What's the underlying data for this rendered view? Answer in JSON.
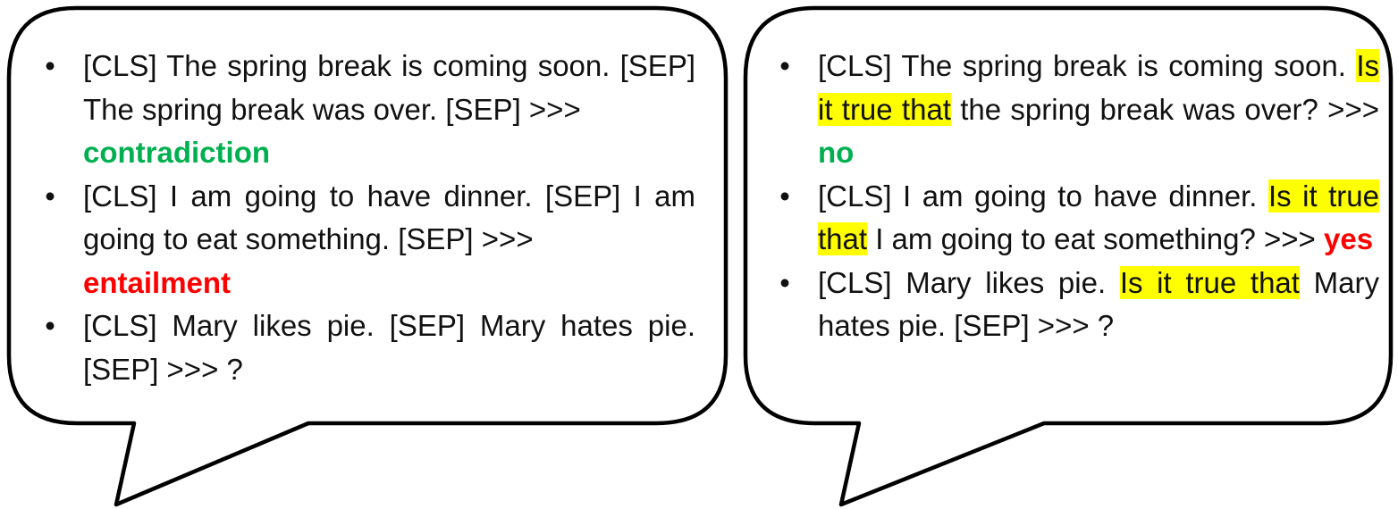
{
  "left_bubble": {
    "items": [
      {
        "text": "[CLS] The spring break is coming soon. [SEP] The spring break was over. [SEP] >>>",
        "label": "contradiction",
        "label_color": "#00b050"
      },
      {
        "text": "[CLS] I am going to have dinner. [SEP] I am going to eat something. [SEP] >>>",
        "label": "entailment",
        "label_color": "#ff0000"
      },
      {
        "text": "[CLS] Mary likes pie. [SEP] Mary hates pie. [SEP] >>> ?"
      }
    ]
  },
  "right_bubble": {
    "items": [
      {
        "before": "[CLS] The spring break is coming soon.",
        "highlight": "Is it true that",
        "after": "the spring break was over? >>>",
        "label": "no",
        "label_color": "#00b050"
      },
      {
        "before": "[CLS] I am going to have dinner.",
        "highlight": "Is it true that",
        "after": "I am going to eat something? >>>",
        "label": "yes",
        "label_color": "#ff0000"
      },
      {
        "before": "[CLS] Mary likes pie.",
        "highlight": "Is it true that",
        "after": "Mary hates pie. [SEP] >>> ?"
      }
    ]
  },
  "bullet_glyph": "•",
  "highlight_color": "#ffff00"
}
